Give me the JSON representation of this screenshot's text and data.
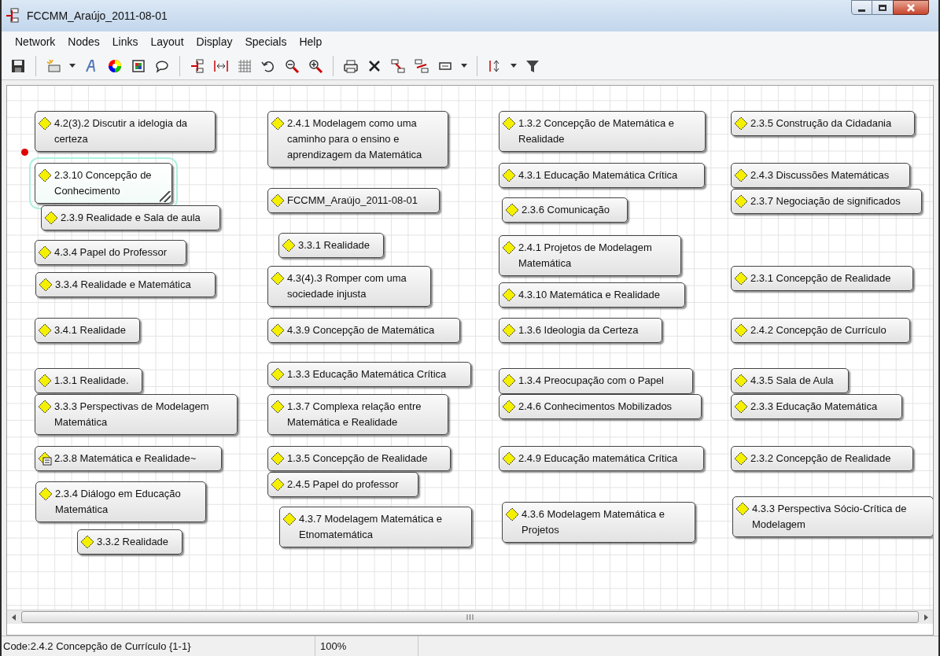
{
  "window": {
    "title": "FCCMM_Araújo_2011-08-01"
  },
  "menu": [
    "Network",
    "Nodes",
    "Links",
    "Layout",
    "Display",
    "Specials",
    "Help"
  ],
  "nodes": [
    {
      "kind": "code",
      "label": "4.2(3).2 Discutir a idelogia da certeza",
      "selected": false
    },
    {
      "kind": "code",
      "label": "2.3.10 Concepção de Conhecimento",
      "selected": true
    },
    {
      "kind": "code",
      "label": "2.3.9 Realidade e Sala de aula",
      "selected": false
    },
    {
      "kind": "code",
      "label": "4.3.4 Papel do Professor",
      "selected": false
    },
    {
      "kind": "code",
      "label": "3.3.4 Realidade e Matemática",
      "selected": false
    },
    {
      "kind": "code",
      "label": "3.4.1 Realidade",
      "selected": false
    },
    {
      "kind": "code",
      "label": "1.3.1 Realidade.",
      "selected": false
    },
    {
      "kind": "code",
      "label": "3.3.3 Perspectivas de Modelagem Matemática",
      "selected": false
    },
    {
      "kind": "memo",
      "label": "2.3.8 Matemática e Realidade~",
      "selected": false
    },
    {
      "kind": "code",
      "label": "2.3.4 Diálogo em Educação Matemática",
      "selected": false
    },
    {
      "kind": "code",
      "label": "3.3.2 Realidade",
      "selected": false
    },
    {
      "kind": "code",
      "label": "2.4.1 Modelagem como uma caminho para o ensino e aprendizagem da Matemática",
      "selected": false
    },
    {
      "kind": "code",
      "label": "FCCMM_Araújo_2011-08-01",
      "selected": false
    },
    {
      "kind": "code",
      "label": "3.3.1 Realidade",
      "selected": false
    },
    {
      "kind": "code",
      "label": "4.3(4).3 Romper com uma sociedade injusta",
      "selected": false
    },
    {
      "kind": "code",
      "label": "4.3.9 Concepção de Matemática",
      "selected": false
    },
    {
      "kind": "code",
      "label": "1.3.3 Educação Matemática Crítica",
      "selected": false
    },
    {
      "kind": "code",
      "label": "1.3.7 Complexa relação entre Matemática e Realidade",
      "selected": false
    },
    {
      "kind": "code",
      "label": "1.3.5 Concepção de Realidade",
      "selected": false
    },
    {
      "kind": "code",
      "label": "2.4.5 Papel do professor",
      "selected": false
    },
    {
      "kind": "code",
      "label": "4.3.7 Modelagem Matemática e Etnomatemática",
      "selected": false
    },
    {
      "kind": "code",
      "label": "1.3.2 Concepção de Matemática e Realidade",
      "selected": false
    },
    {
      "kind": "code",
      "label": "4.3.1 Educação Matemática Crítica",
      "selected": false
    },
    {
      "kind": "code",
      "label": "2.3.6 Comunicação",
      "selected": false
    },
    {
      "kind": "code",
      "label": "2.4.1 Projetos de Modelagem Matemática",
      "selected": false
    },
    {
      "kind": "code",
      "label": "4.3.10 Matemática e Realidade",
      "selected": false
    },
    {
      "kind": "code",
      "label": "1.3.6 Ideologia da Certeza",
      "selected": false
    },
    {
      "kind": "code",
      "label": "1.3.4 Preocupação com o Papel",
      "selected": false
    },
    {
      "kind": "code",
      "label": "2.4.6 Conhecimentos Mobilizados",
      "selected": false
    },
    {
      "kind": "code",
      "label": "2.4.9 Educação matemática Crítica",
      "selected": false
    },
    {
      "kind": "code",
      "label": "4.3.6 Modelagem Matemática e Projetos",
      "selected": false
    },
    {
      "kind": "code",
      "label": "2.3.5 Construção da Cidadania",
      "selected": false
    },
    {
      "kind": "code",
      "label": "2.4.3 Discussões Matemáticas",
      "selected": false
    },
    {
      "kind": "code",
      "label": "2.3.7 Negociação de significados",
      "selected": false
    },
    {
      "kind": "code",
      "label": "2.3.1 Concepção de Realidade",
      "selected": false
    },
    {
      "kind": "code",
      "label": "2.4.2 Concepção de Currículo",
      "selected": false
    },
    {
      "kind": "code",
      "label": "4.3.5 Sala de Aula",
      "selected": false
    },
    {
      "kind": "code",
      "label": "2.3.3 Educação Matemática",
      "selected": false
    },
    {
      "kind": "code",
      "label": "2.3.2 Concepção de Realidade",
      "selected": false
    },
    {
      "kind": "code",
      "label": "4.3.3 Perspectiva Sócio-Crítica de Modelagem",
      "selected": false
    }
  ],
  "status_bar": {
    "code": "Code:2.4.2 Concepção de Currículo {1-1}",
    "zoom": "100%"
  }
}
